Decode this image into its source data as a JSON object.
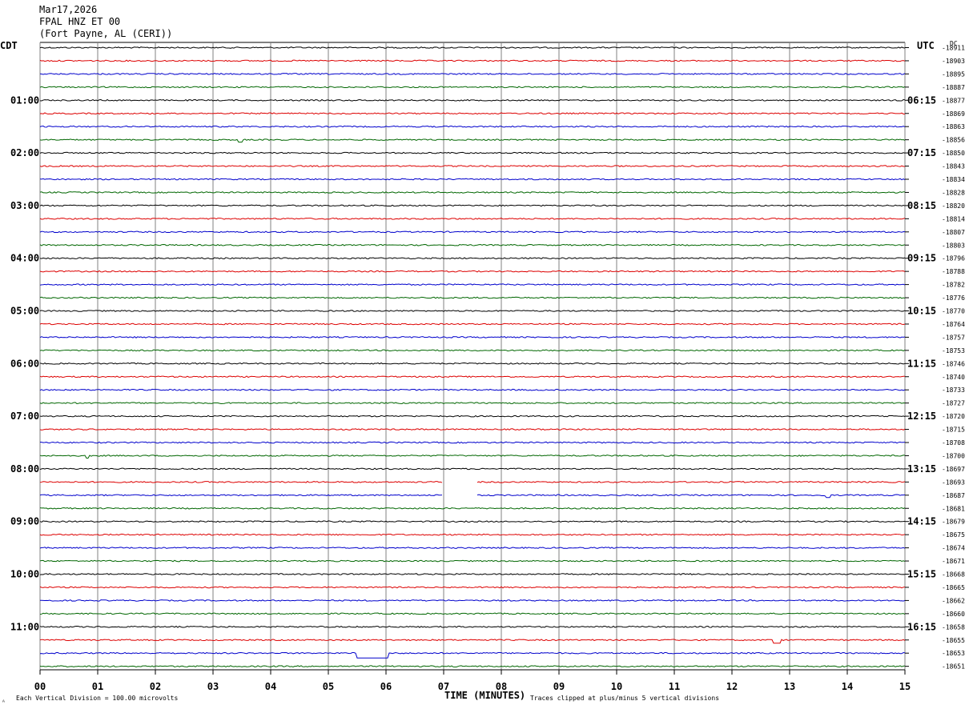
{
  "header": {
    "date": "Mar17,2026",
    "station": "FPAL HNZ ET 00",
    "location": "(Fort Payne, AL (CERI))"
  },
  "left_tz": "CDT",
  "right_tz": "UTC",
  "dc_label": "DC",
  "footer": {
    "scale_note": "Each Vertical Division =  100.00 microvolts",
    "xlabel": "TIME (MINUTES)",
    "clip_note": "Traces clipped at plus/minus 5 vertical divisions",
    "corner_mark": "ᴬ"
  },
  "colors": {
    "trace_cycle": [
      "#000000",
      "#dd0000",
      "#0000cc",
      "#006600"
    ],
    "grid_vertical": "#808080",
    "text": "#000000"
  },
  "chart_data": {
    "type": "line",
    "title": "",
    "xlabel": "TIME (MINUTES)",
    "x_ticks": [
      "00",
      "01",
      "02",
      "03",
      "04",
      "05",
      "06",
      "07",
      "08",
      "09",
      "10",
      "11",
      "12",
      "13",
      "14",
      "15"
    ],
    "xlim": [
      0,
      15
    ],
    "trace_count": 48,
    "left_hour_labels": [
      "01:00",
      "02:00",
      "03:00",
      "04:00",
      "05:00",
      "06:00",
      "07:00",
      "08:00",
      "09:00",
      "10:00",
      "11:00"
    ],
    "left_hour_label_rows": [
      4,
      8,
      12,
      16,
      20,
      24,
      28,
      32,
      36,
      40,
      44
    ],
    "right_hour_labels": [
      "06:15",
      "07:15",
      "08:15",
      "09:15",
      "10:15",
      "11:15",
      "12:15",
      "13:15",
      "14:15",
      "15:15",
      "16:15"
    ],
    "right_hour_label_rows": [
      4,
      8,
      12,
      16,
      20,
      24,
      28,
      32,
      36,
      40,
      44
    ],
    "dc_offsets": [
      "-18911",
      "-18903",
      "-18895",
      "-18887",
      "-18877",
      "-18869",
      "-18863",
      "-18856",
      "-18850",
      "-18843",
      "-18834",
      "-18828",
      "-18820",
      "-18814",
      "-18807",
      "-18803",
      "-18796",
      "-18788",
      "-18782",
      "-18776",
      "-18770",
      "-18764",
      "-18757",
      "-18753",
      "-18746",
      "-18740",
      "-18733",
      "-18727",
      "-18720",
      "-18715",
      "-18708",
      "-18700",
      "-18697",
      "-18693",
      "-18687",
      "-18681",
      "-18679",
      "-18675",
      "-18674",
      "-18671",
      "-18668",
      "-18665",
      "-18662",
      "-18660",
      "-18658",
      "-18655",
      "-18653",
      "-18651"
    ],
    "anomalies": [
      {
        "row": 7,
        "x_min": 3.42,
        "width_min": 0.1,
        "depth": 3
      },
      {
        "row": 31,
        "x_min": 0.78,
        "width_min": 0.08,
        "depth": 3
      },
      {
        "row": 34,
        "x_min": 13.62,
        "width_min": 0.1,
        "depth": 3
      },
      {
        "row": 45,
        "x_min": 12.72,
        "width_min": 0.12,
        "depth": 4
      },
      {
        "row": 46,
        "x_min": 5.5,
        "width_min": 0.55,
        "depth": 6
      }
    ],
    "gaps": [
      {
        "row": 33,
        "x_start_min": 7.0,
        "x_end_min": 7.58
      },
      {
        "row": 34,
        "x_start_min": 7.0,
        "x_end_min": 7.58
      }
    ]
  }
}
